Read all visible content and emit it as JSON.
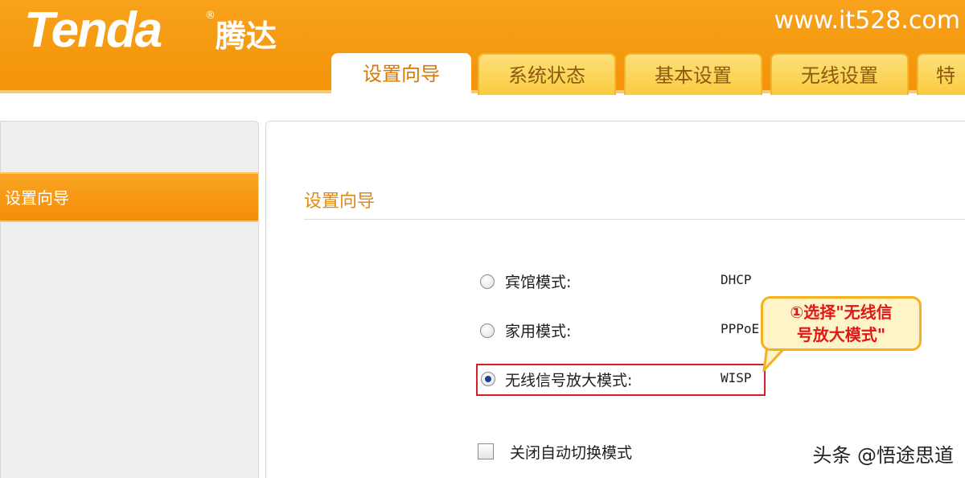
{
  "header": {
    "brand_en": "Tenda",
    "brand_reg": "®",
    "brand_cn": "腾达",
    "site": "www.it528.com"
  },
  "tabs": [
    {
      "label": "设置向导",
      "active": true
    },
    {
      "label": "系统状态"
    },
    {
      "label": "基本设置"
    },
    {
      "label": "无线设置"
    },
    {
      "label": "特"
    }
  ],
  "sidebar": {
    "active_item": "设置向导"
  },
  "main": {
    "title": "设置向导",
    "options": [
      {
        "label": "宾馆模式:",
        "value": "DHCP",
        "selected": false
      },
      {
        "label": "家用模式:",
        "value": "PPPoE",
        "selected": false
      },
      {
        "label": "无线信号放大模式:",
        "value": "WISP",
        "selected": true
      }
    ],
    "checkbox_label": "关闭自动切换模式"
  },
  "annotation": {
    "line1": "①选择\"无线信",
    "line2": "号放大模式\""
  },
  "watermark": "头条 @悟途思道",
  "colors": {
    "brand_orange": "#f59a10",
    "highlight_red": "#d8202a",
    "title_orange": "#e08a10"
  }
}
